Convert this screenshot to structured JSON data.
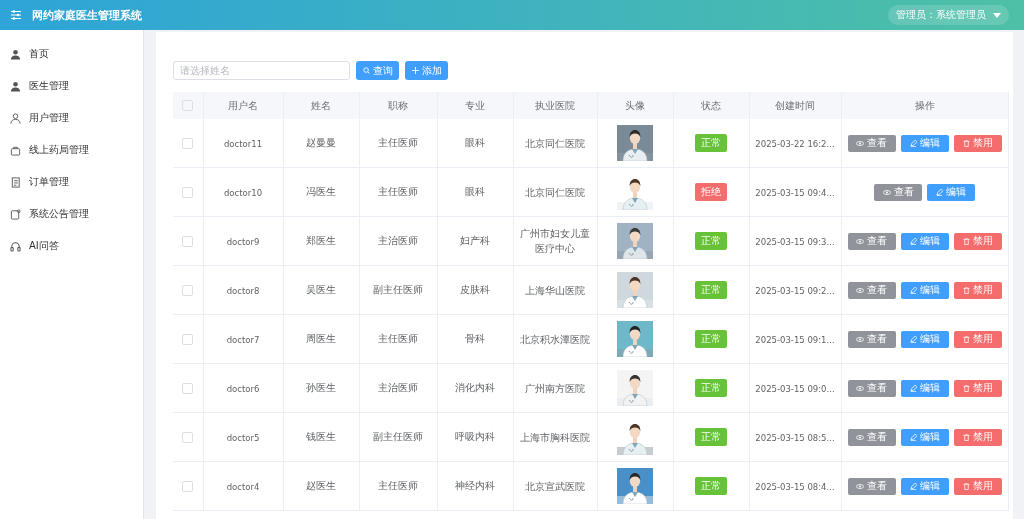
{
  "header": {
    "title": "网约家庭医生管理系统",
    "user": "管理员：系统管理员"
  },
  "sidebar": {
    "items": [
      {
        "kind": "home",
        "label": "首页"
      },
      {
        "kind": "doctor",
        "label": "医生管理"
      },
      {
        "kind": "user",
        "label": "用户管理"
      },
      {
        "kind": "pharmacy",
        "label": "线上药局管理"
      },
      {
        "kind": "order",
        "label": "订单管理"
      },
      {
        "kind": "notice",
        "label": "系统公告管理"
      },
      {
        "kind": "ai",
        "label": "AI问答"
      }
    ]
  },
  "toolbar": {
    "search": {
      "placeholder": "请选择姓名"
    },
    "buttons": [
      {
        "kind": "search",
        "label": "查询"
      },
      {
        "kind": "add",
        "label": "添加"
      }
    ]
  },
  "table": {
    "select_all": {
      "checked": false
    },
    "columns": [
      "用户名",
      "姓名",
      "职称",
      "专业",
      "执业医院",
      "头像",
      "状态",
      "创建时间",
      "操作"
    ],
    "rows": [
      {
        "checked": false,
        "username": "doctor11",
        "name": "赵曼曼",
        "title": "主任医师",
        "major": "眼科",
        "hospital": "北京同仁医院",
        "avatar": {
          "kind": "picture"
        },
        "status": {
          "kind": "ok",
          "label": "正常"
        },
        "created": "2025-03-22 16:2...",
        "actions": [
          {
            "kind": "view",
            "label": "查看"
          },
          {
            "kind": "edit",
            "label": "编辑"
          },
          {
            "kind": "disable",
            "label": "禁用"
          }
        ]
      },
      {
        "checked": false,
        "username": "doctor10",
        "name": "冯医生",
        "title": "主任医师",
        "major": "眼科",
        "hospital": "北京同仁医院",
        "avatar": {
          "kind": "picture"
        },
        "status": {
          "kind": "rejected",
          "label": "拒绝"
        },
        "created": "2025-03-15 09:4...",
        "actions": [
          {
            "kind": "view",
            "label": "查看"
          },
          {
            "kind": "edit",
            "label": "编辑"
          }
        ]
      },
      {
        "checked": false,
        "username": "doctor9",
        "name": "郑医生",
        "title": "主治医师",
        "major": "妇产科",
        "hospital": "广州市妇女儿童医疗中心",
        "avatar": {
          "kind": "picture"
        },
        "status": {
          "kind": "ok",
          "label": "正常"
        },
        "created": "2025-03-15 09:3...",
        "actions": [
          {
            "kind": "view",
            "label": "查看"
          },
          {
            "kind": "edit",
            "label": "编辑"
          },
          {
            "kind": "disable",
            "label": "禁用"
          }
        ]
      },
      {
        "checked": false,
        "username": "doctor8",
        "name": "吴医生",
        "title": "副主任医师",
        "major": "皮肤科",
        "hospital": "上海华山医院",
        "avatar": {
          "kind": "picture"
        },
        "status": {
          "kind": "ok",
          "label": "正常"
        },
        "created": "2025-03-15 09:2...",
        "actions": [
          {
            "kind": "view",
            "label": "查看"
          },
          {
            "kind": "edit",
            "label": "编辑"
          },
          {
            "kind": "disable",
            "label": "禁用"
          }
        ]
      },
      {
        "checked": false,
        "username": "doctor7",
        "name": "周医生",
        "title": "主任医师",
        "major": "骨科",
        "hospital": "北京积水潭医院",
        "avatar": {
          "kind": "picture"
        },
        "status": {
          "kind": "ok",
          "label": "正常"
        },
        "created": "2025-03-15 09:1...",
        "actions": [
          {
            "kind": "view",
            "label": "查看"
          },
          {
            "kind": "edit",
            "label": "编辑"
          },
          {
            "kind": "disable",
            "label": "禁用"
          }
        ]
      },
      {
        "checked": false,
        "username": "doctor6",
        "name": "孙医生",
        "title": "主治医师",
        "major": "消化内科",
        "hospital": "广州南方医院",
        "avatar": {
          "kind": "picture"
        },
        "status": {
          "kind": "ok",
          "label": "正常"
        },
        "created": "2025-03-15 09:0...",
        "actions": [
          {
            "kind": "view",
            "label": "查看"
          },
          {
            "kind": "edit",
            "label": "编辑"
          },
          {
            "kind": "disable",
            "label": "禁用"
          }
        ]
      },
      {
        "checked": false,
        "username": "doctor5",
        "name": "钱医生",
        "title": "副主任医师",
        "major": "呼吸内科",
        "hospital": "上海市胸科医院",
        "avatar": {
          "kind": "picture"
        },
        "status": {
          "kind": "ok",
          "label": "正常"
        },
        "created": "2025-03-15 08:5...",
        "actions": [
          {
            "kind": "view",
            "label": "查看"
          },
          {
            "kind": "edit",
            "label": "编辑"
          },
          {
            "kind": "disable",
            "label": "禁用"
          }
        ]
      },
      {
        "checked": false,
        "username": "doctor4",
        "name": "赵医生",
        "title": "主任医师",
        "major": "神经内科",
        "hospital": "北京宣武医院",
        "avatar": {
          "kind": "picture"
        },
        "status": {
          "kind": "ok",
          "label": "正常"
        },
        "created": "2025-03-15 08:4...",
        "actions": [
          {
            "kind": "view",
            "label": "查看"
          },
          {
            "kind": "edit",
            "label": "编辑"
          },
          {
            "kind": "disable",
            "label": "禁用"
          }
        ]
      }
    ]
  }
}
